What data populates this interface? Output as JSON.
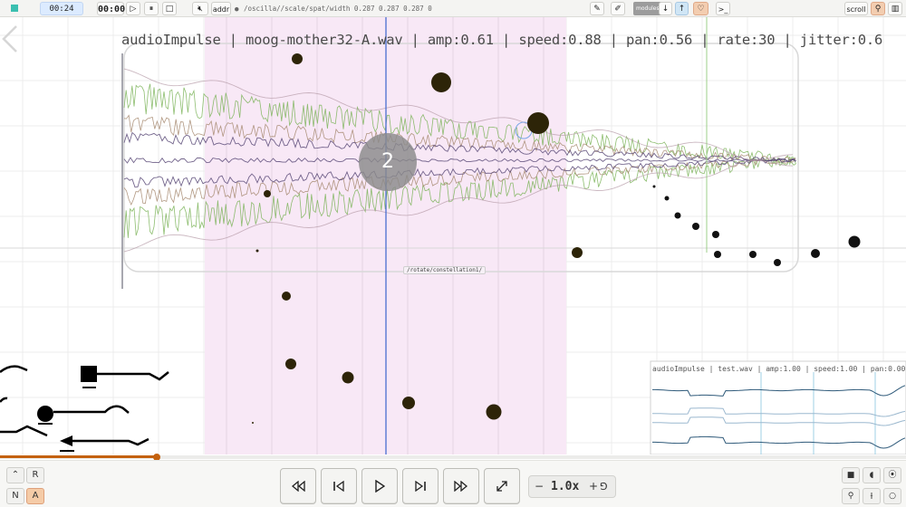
{
  "toolbar": {
    "time_current": "00:24",
    "time_playhead": "00:00",
    "addr_label": "addr",
    "osc_path": "/oscilla//scale/spat/width 0.287 0.287 0.287 0",
    "mode_tag": "modules",
    "scroll_label": "scroll"
  },
  "canvas": {
    "track_title": "audioImpulse | moog-mother32-A.wav | amp:0.61 | speed:0.88 | pan:0.56 | rate:30 | jitter:0.6",
    "constellation_count": "2",
    "osc_label": "/rotate/constellation1/",
    "mini_track_title": "audioImpulse | test.wav | amp:1.00 | speed:1.00 | pan:0.00 |"
  },
  "progress": {
    "fraction": 0.173
  },
  "bottom": {
    "left_buttons": [
      {
        "label": "⌃",
        "name": "collapse-button"
      },
      {
        "label": "R",
        "name": "r-button"
      },
      {
        "label": "N",
        "name": "n-button"
      },
      {
        "label": "A",
        "name": "a-button"
      }
    ],
    "speed_value": "1.0x",
    "speed_minus": "−",
    "speed_plus": "+",
    "speed_reset": "⅁"
  },
  "colors": {
    "accent": "#c4610e",
    "highlight_region": "#f8e8f6",
    "wave_green": "#7ab357",
    "wave_brown": "#a5876d",
    "wave_purple": "#5a4a78",
    "playhead": "#4a6ed0"
  }
}
